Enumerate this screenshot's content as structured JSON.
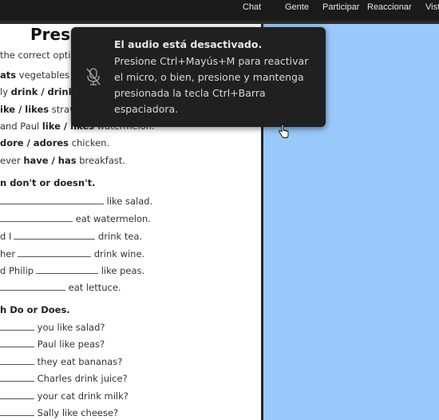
{
  "topbar": {
    "items": [
      "Chat",
      "Gente",
      "Participar",
      "Reaccionar",
      "Vist"
    ]
  },
  "worksheet": {
    "title": "Prese",
    "instruction1": "the correct optio",
    "rows1": [
      {
        "pre": "",
        "bold": "ats",
        "post": " vegetables e"
      },
      {
        "pre": "ly ",
        "bold": "drink / drinks",
        "post": ""
      },
      {
        "pre": "",
        "bold": "ike / likes",
        "post": " strawb"
      },
      {
        "pre": "and Paul ",
        "bold": "like / likes",
        "post": " watermelon."
      },
      {
        "pre": "",
        "bold": "dore / adores",
        "post": " chicken."
      },
      {
        "pre": "ever ",
        "bold": "have / has",
        "post": " breakfast."
      }
    ],
    "section2": "n don't or doesn't.",
    "rows2": [
      {
        "pre": "",
        "post": " like salad."
      },
      {
        "pre": "",
        "post": " eat watermelon."
      },
      {
        "pre": "d I",
        "post": " drink tea."
      },
      {
        "pre": "her",
        "post": " drink wine."
      },
      {
        "pre": "d Philip",
        "post": " like peas."
      },
      {
        "pre": "",
        "post": " eat lettuce."
      }
    ],
    "section3": "h Do or Does.",
    "rows3": [
      " you like salad?",
      " Paul like peas?",
      " they eat bananas?",
      " Charles drink juice?",
      " your cat drink milk?",
      " Sally like cheese?"
    ]
  },
  "notification": {
    "icon": "mic-off-icon",
    "title": "El audio está desactivado.",
    "message": "Presione Ctrl+Mayús+M para reactivar el micro, o bien, presione y mantenga presionada la tecla Ctrl+Barra espaciadora."
  },
  "colors": {
    "stage": "#99c9fb",
    "toast_bg": "#202020",
    "topbar_bg": "#1a1a1a"
  }
}
